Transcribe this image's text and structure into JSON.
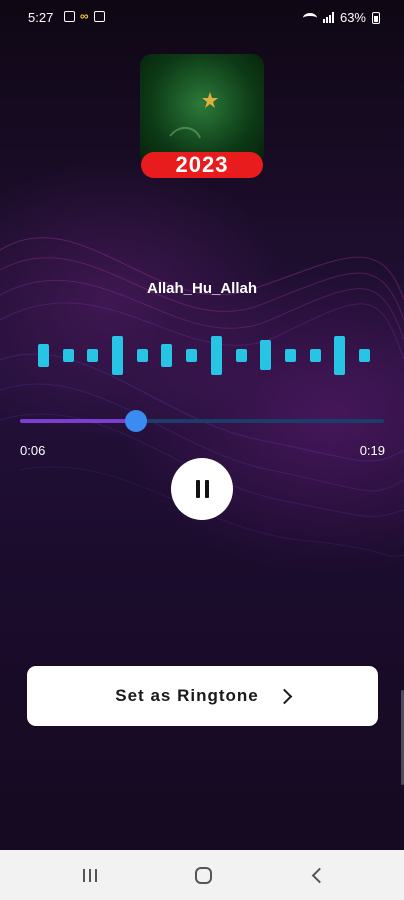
{
  "status_bar": {
    "time": "5:27",
    "battery": "63%"
  },
  "app_icon": {
    "year_label": "2023",
    "icon": "crescent-moon-star-icon"
  },
  "player": {
    "track_title": "Allah_Hu_Allah",
    "current_time": "0:06",
    "total_time": "0:19",
    "progress": 0.32,
    "equalizer_levels": [
      0.5,
      0.28,
      0.28,
      0.85,
      0.28,
      0.5,
      0.28,
      0.85,
      0.28,
      0.65,
      0.28,
      0.28,
      0.85,
      0.28
    ],
    "pause_icon": "pause-icon"
  },
  "actions": {
    "set_ringtone_label": "Set as Ringtone",
    "chevron_icon": "chevron-right-icon"
  },
  "colors": {
    "equalizer": "#27c4e6",
    "progress_fill": "#7b3fd0",
    "progress_track": "#1d3c6a",
    "thumb": "#3b8cf0",
    "year_badge": "#e81c1c"
  }
}
